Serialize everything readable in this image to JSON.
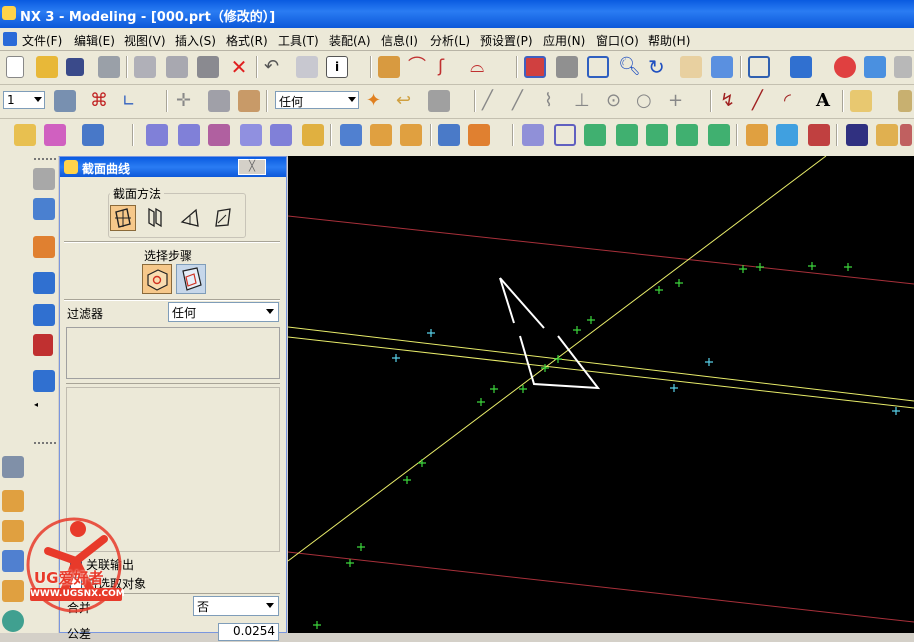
{
  "window": {
    "title": "NX 3 - Modeling - [000.prt（修改的）]"
  },
  "menu": [
    "文件(F)",
    "编辑(E)",
    "视图(V)",
    "插入(S)",
    "格式(R)",
    "工具(T)",
    "装配(A)",
    "信息(I)",
    "分析(L)",
    "预设置(P)",
    "应用(N)",
    "窗口(O)",
    "帮助(H)"
  ],
  "toolbar": {
    "layer_value": "1",
    "filter_value": "任何",
    "text_icon_label": "A"
  },
  "dialog": {
    "title": "截面曲线",
    "close_label": "╳",
    "method_label": "截面方法",
    "step_label": "选择步骤",
    "filter_label": "过滤器",
    "filter_value": "任何",
    "associative_label": "关联输出",
    "deselect_label": "将选取对象",
    "merge_label": "合并",
    "merge_value": "否",
    "tolerance_label": "公差",
    "tolerance_value": "0.0254"
  },
  "watermark": {
    "brand": "UG爱好者",
    "url": "WWW.UGSNX.COM"
  },
  "colors": {
    "accent": "#0a5be0",
    "selected": "#f6c88a",
    "viewport": "#000000",
    "curve_yellow": "#e8ec6a",
    "curve_red": "#a8303a",
    "point_green": "#3cd63c",
    "point_cyan": "#58d0e8"
  }
}
